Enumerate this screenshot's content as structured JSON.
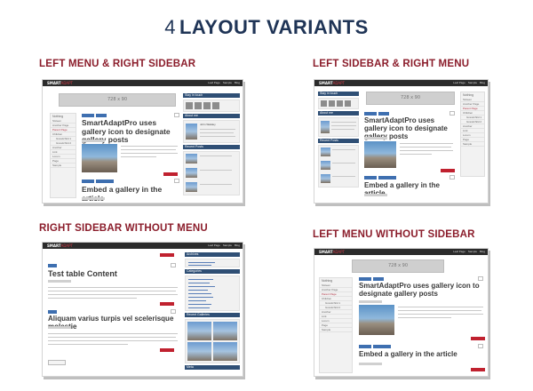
{
  "title": {
    "number": "4",
    "text": "LAYOUT VARIANTS"
  },
  "variants": [
    {
      "title": "LEFT MENU & RIGHT SIDEBAR"
    },
    {
      "title": "LEFT SIDEBAR & RIGHT MENU"
    },
    {
      "title": "RIGHT SIDEBAR WITHOUT MENU"
    },
    {
      "title": "LEFT MENU WITHOUT SIDEBAR"
    }
  ],
  "mock": {
    "logo_main": "SMART",
    "logo_accent": "ADAPT",
    "nav": [
      "Leaf Page",
      "Sample",
      "Blog"
    ],
    "banner": "728 x 90",
    "post_gallery_icon": "SmartAdaptPro uses gallery icon to designate gallery posts",
    "post_embed_gallery": "Embed a gallery in the article",
    "post_table": "Test table Content",
    "post_aliquam": "Aliquam varius turpis vel scelerisque molestie",
    "menu_heading": "Nothing",
    "menu_items": [
      "Sixteen",
      "Another Page",
      "Parent Page",
      "Children",
      "Grandchild 1",
      "Grandchild 2",
      "Another",
      "Link",
      "Lorem",
      "Page",
      "Sample"
    ],
    "sidebar_headings": [
      "Stay in touch",
      "About me",
      "Recent Posts",
      "Archives",
      "Categories",
      "Recent Galleries",
      "Meta"
    ],
    "author": "John Walsley"
  }
}
